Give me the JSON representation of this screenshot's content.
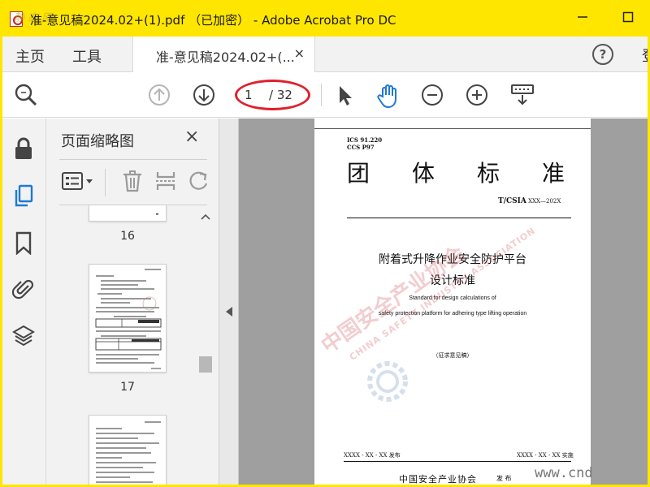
{
  "window": {
    "title": "准-意见稿2024.02+(1).pdf （已加密） - Adobe Acrobat Pro DC",
    "watermark_top": "静 态 网",
    "minimize_icon": "minimize-icon",
    "restore_icon": "maximize-icon"
  },
  "tabs": {
    "home": "主页",
    "tools": "工具",
    "document": "准-意见稿2024.02+(...",
    "close": "×",
    "help": "?",
    "signin": "登"
  },
  "toolbar": {
    "page_current": "1",
    "page_total": "/ 32",
    "accent": "#1e7ad4",
    "highlight_color": "#e0202a"
  },
  "thumbnails": {
    "title": "页面缩略图",
    "close": "×",
    "pages": [
      {
        "number": "16"
      },
      {
        "number": "17"
      },
      {
        "number": ""
      }
    ]
  },
  "document": {
    "ics": "ICS  91.220",
    "ccs": "CCS  P97",
    "header_chars": [
      "团",
      "体",
      "标",
      "准"
    ],
    "code_bold": "T/CSIA",
    "code_rest": " XXX—202X",
    "title_line1": "附着式升降作业安全防护平台",
    "title_line2": "设计标准",
    "en_line1": "Standard for design calculations of",
    "en_line2": "safety protection platform for adhering type lifting operation",
    "draft": "（征求意见稿）",
    "release": "XXXX - XX - XX 发布",
    "implement": "XXXX - XX - XX 实施",
    "publisher": "中国安全产业协会",
    "publish_word": "发 布",
    "stamp_text": "中国安全产业协会",
    "stamp_en": "CHINA SAFETY INDUSTRY ASSOCIATION"
  },
  "site_watermark": "www.cnd"
}
